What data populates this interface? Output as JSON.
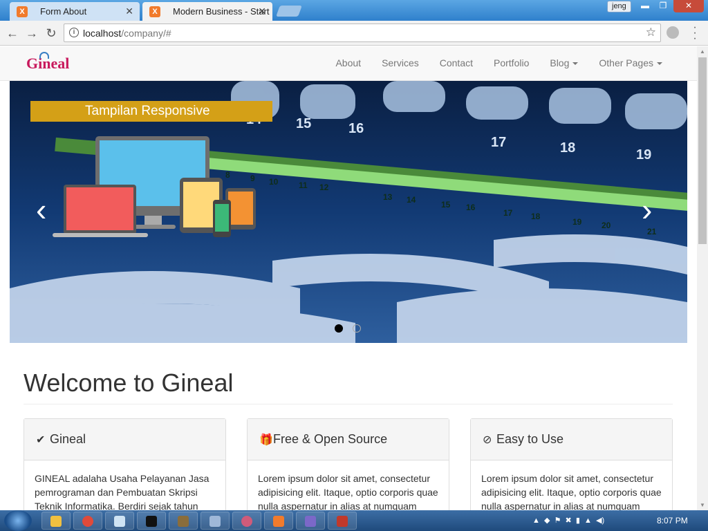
{
  "browser": {
    "tabs": [
      {
        "title": "Form About",
        "favicon": "X"
      },
      {
        "title": "Modern Business - Start",
        "favicon": "X"
      }
    ],
    "user": "jeng",
    "url_host": "localhost",
    "url_path": "/company/#"
  },
  "site": {
    "logo": "Gineal",
    "nav": [
      {
        "label": "About"
      },
      {
        "label": "Services"
      },
      {
        "label": "Contact"
      },
      {
        "label": "Portfolio"
      },
      {
        "label": "Blog"
      },
      {
        "label": "Other Pages"
      }
    ]
  },
  "carousel": {
    "caption": "Tampilan Responsive",
    "port_numbers": [
      "14",
      "15",
      "16",
      "17",
      "18",
      "19",
      "8",
      "9",
      "10",
      "11",
      "12",
      "13",
      "14",
      "15",
      "16",
      "17",
      "18",
      "19",
      "20",
      "21"
    ],
    "slide_count": 2,
    "active_slide": 1
  },
  "main": {
    "heading": "Welcome to Gineal",
    "panels": [
      {
        "title": "Gineal",
        "icon": "check-icon",
        "body": "GINEAL adalaha Usaha Pelayanan Jasa pemrograman dan Pembuatan Skripsi Teknik Informatika. Berdiri sejak tahun"
      },
      {
        "title": "Free & Open Source",
        "icon": "gift-icon",
        "body": "Lorem ipsum dolor sit amet, consectetur adipisicing elit. Itaque, optio corporis quae nulla aspernatur in alias at numquam"
      },
      {
        "title": "Easy to Use",
        "icon": "compass-icon",
        "body": "Lorem ipsum dolor sit amet, consectetur adipisicing elit. Itaque, optio corporis quae nulla aspernatur in alias at numquam"
      }
    ]
  },
  "taskbar": {
    "clock": "8:07 PM"
  },
  "colors": {
    "accent": "#d4a017",
    "logo": "#c8195d",
    "nav_text": "#777777"
  }
}
